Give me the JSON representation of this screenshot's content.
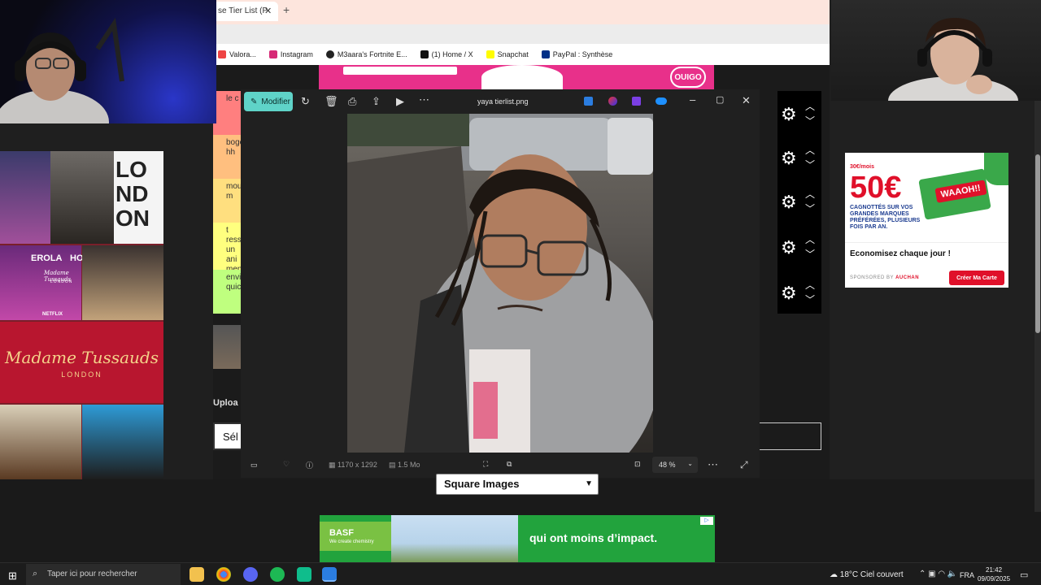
{
  "browser": {
    "tab_title": "se Tier List (P",
    "tab_close": "✕",
    "new_tab": "+",
    "bookmarks": [
      {
        "label": "Valora...",
        "color": "#e44"
      },
      {
        "label": "Instagram",
        "color": "#d62976"
      },
      {
        "label": "M3aara's Fortnite E...",
        "color": "#222"
      },
      {
        "label": "(1) Home / X",
        "color": "#111"
      },
      {
        "label": "Snapchat",
        "color": "#fffc00"
      },
      {
        "label": "PayPal : Synthèse",
        "color": "#003087"
      }
    ]
  },
  "tiers": [
    {
      "label": "le c",
      "color": "#ff7f7f"
    },
    {
      "label": "boge hh",
      "color": "#ffbf7f"
    },
    {
      "label": "moua m",
      "color": "#ffdf7f"
    },
    {
      "label": "t ressem un ani mens",
      "color": "#ffff7f"
    },
    {
      "label": "envie quick",
      "color": "#bfff7f"
    }
  ],
  "viewer": {
    "edit_label": "Modifier",
    "title": "yaya tierlist.png",
    "dimensions": "1170 x 1292",
    "filesize": "1.5 Mo",
    "zoom": "48 %",
    "icons": [
      "rotate-icon",
      "delete-icon",
      "print-icon",
      "share-icon",
      "slideshow-icon",
      "more-icon"
    ]
  },
  "upload": {
    "label": "Uploa",
    "select_button": "Sél"
  },
  "square_select": {
    "value": "Square Images"
  },
  "left_ad": {
    "brand": "Madame Tussauds",
    "city": "LONDON",
    "letters": [
      "LO",
      "ND",
      "ON"
    ],
    "sign_left": "EROLA",
    "sign_right": "HO",
    "tag_netflix": "NETFLIX",
    "sign_tussauds": "Madame Tussauds",
    "sign_city": "LONDON"
  },
  "right_ad": {
    "brand_top": "30€/mois",
    "price": "50€",
    "text": "CAGNOTTÉS SUR VOS GRANDES MARQUES PRÉFÉRÉES, PLUSIEURS FOIS PAR AN.",
    "card": "WAAOH!!",
    "tagline": "Economisez chaque jour !",
    "sponsor_prefix": "SPONSORED BY",
    "sponsor_brand": "AUCHAN",
    "cta": "Créer Ma Carte"
  },
  "bottom_ad": {
    "logo": "BASF",
    "logo_sub": "We create chemistry",
    "text": "qui ont moins d’impact."
  },
  "top_ad": {
    "logo": "OUIGO"
  },
  "taskbar": {
    "search_placeholder": "Taper ici pour rechercher",
    "weather": "18°C  Ciel couvert",
    "lang": "FRA",
    "time": "21:42",
    "date": "09/09/2025"
  },
  "colors": {
    "accent_teal": "#5fd3c8",
    "basf_green": "#22a33d",
    "auchan_red": "#e0102a"
  }
}
